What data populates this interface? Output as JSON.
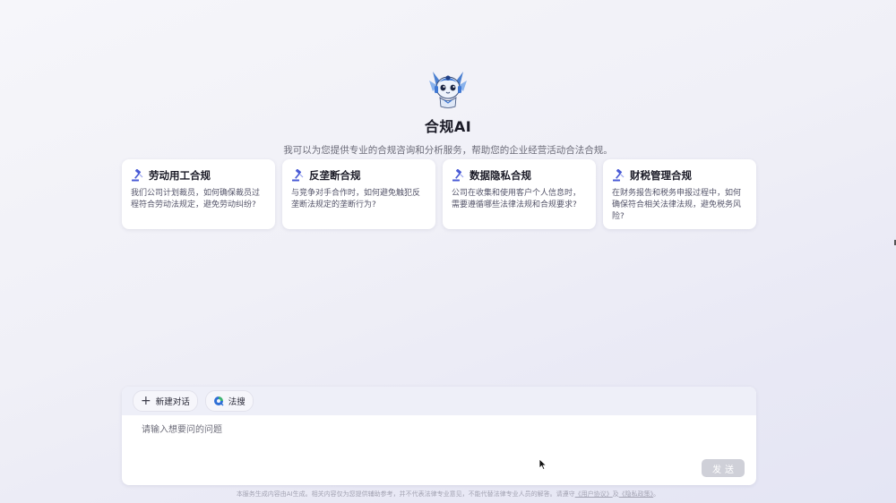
{
  "hero": {
    "title": "合规AI",
    "subtitle": "我可以为您提供专业的合规咨询和分析服务，帮助您的企业经营活动合法合规。",
    "mascot_icon": "cat-mascot-icon"
  },
  "cards": [
    {
      "icon": "gavel-icon",
      "title": "劳动用工合规",
      "desc": "我们公司计划裁员，如何确保裁员过程符合劳动法规定，避免劳动纠纷?"
    },
    {
      "icon": "gavel-icon",
      "title": "反垄断合规",
      "desc": "与竞争对手合作时，如何避免触犯反垄断法规定的垄断行为?"
    },
    {
      "icon": "gavel-icon",
      "title": "数据隐私合规",
      "desc": "公司在收集和使用客户个人信息时，需要遵循哪些法律法规和合规要求?"
    },
    {
      "icon": "gavel-icon",
      "title": "财税管理合规",
      "desc": "在财务报告和税务申报过程中，如何确保符合相关法律法规，避免税务风险?"
    }
  ],
  "composer": {
    "new_chat_label": "新建对话",
    "new_chat_icon": "plus-icon",
    "fasou_label": "法搜",
    "fasou_icon": "search-logo-icon",
    "input_placeholder": "请输入想要问的问题",
    "send_label": "发送"
  },
  "footer": {
    "text": "本服务生成内容由AI生成。相关内容仅为您提供辅助参考，并不代表法律专业意见，不能代替法律专业人员的解答。请遵守",
    "user_agreement": "《用户协议》",
    "and": "及",
    "privacy_policy": "《隐私政策》",
    "end": "。"
  },
  "colors": {
    "accent": "#4a5bd6",
    "send_disabled": "#cfd0d8",
    "toolbar_bg": "#eeeff8"
  }
}
